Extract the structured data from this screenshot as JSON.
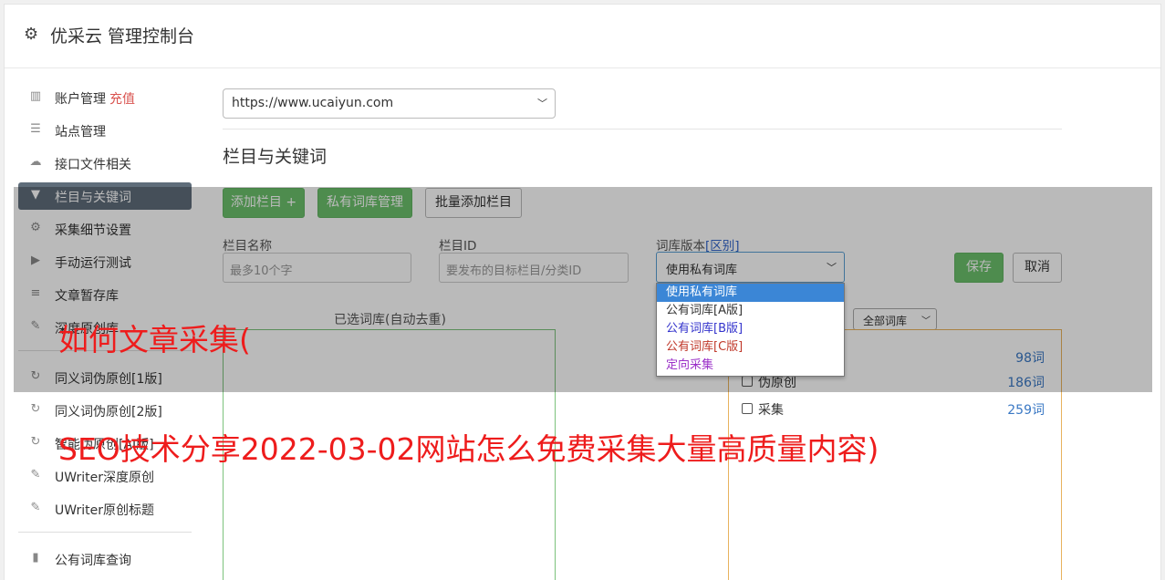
{
  "header": {
    "icon": "gear-icon",
    "title": "优采云 管理控制台"
  },
  "sidebar": {
    "items": [
      {
        "icon": "bar-chart-icon",
        "glyph": "▥",
        "label": "账户管理",
        "extra": "充值"
      },
      {
        "icon": "server-icon",
        "glyph": "☰",
        "label": "站点管理"
      },
      {
        "icon": "cloud-upload-icon",
        "glyph": "☁",
        "label": "接口文件相关"
      },
      {
        "icon": "filter-icon",
        "glyph": "▼",
        "label": "栏目与关键词"
      },
      {
        "icon": "cogs-icon",
        "glyph": "⚙",
        "label": "采集细节设置"
      },
      {
        "icon": "play-circle-icon",
        "glyph": "▶",
        "label": "手动运行测试"
      },
      {
        "icon": "database-icon",
        "glyph": "≡",
        "label": "文章暂存库"
      },
      {
        "icon": "edit-icon",
        "glyph": "✎",
        "label": "深度原创库"
      }
    ],
    "items2": [
      {
        "icon": "refresh-icon",
        "glyph": "↻",
        "label": "同义词伪原创[1版]"
      },
      {
        "icon": "refresh-icon",
        "glyph": "↻",
        "label": "同义词伪原创[2版]"
      },
      {
        "icon": "refresh-icon",
        "glyph": "↻",
        "label": "智能伪原创[AI版]"
      },
      {
        "icon": "edit-icon",
        "glyph": "✎",
        "label": "UWriter深度原创"
      },
      {
        "icon": "edit-icon",
        "glyph": "✎",
        "label": "UWriter原创标题"
      }
    ],
    "items3": [
      {
        "icon": "book-icon",
        "glyph": "▮",
        "label": "公有词库查询"
      }
    ]
  },
  "site_select": {
    "value": "https://www.ucaiyun.com"
  },
  "section": {
    "title": "栏目与关键词"
  },
  "buttons": {
    "add_column": "添加栏目 +",
    "private_lib": "私有词库管理",
    "batch_add": "批量添加栏目",
    "save": "保存",
    "cancel": "取消"
  },
  "form": {
    "column_name_label": "栏目名称",
    "column_name_placeholder": "最多10个字",
    "column_id_label": "栏目ID",
    "column_id_placeholder": "要发布的目标栏目/分类ID",
    "lib_version_label": "词库版本",
    "lib_version_link": "[区别]",
    "lib_version_value": "使用私有词库"
  },
  "dropdown": {
    "options": [
      {
        "label": "使用私有词库",
        "color": "#ffffff",
        "selected": true
      },
      {
        "label": "公有词库[A版]",
        "color": "#333333"
      },
      {
        "label": "公有词库[B版]",
        "color": "#3333cc"
      },
      {
        "label": "公有词库[C版]",
        "color": "#c0392b"
      },
      {
        "label": "定向采集",
        "color": "#9b30c8"
      }
    ]
  },
  "selected_libs": {
    "caption": "已选词库(自动去重)"
  },
  "all_libs": {
    "filter_value": "全部词库",
    "rows": [
      {
        "name": "",
        "count": "98词"
      },
      {
        "name": "伪原创",
        "count": "186词"
      },
      {
        "name": "采集",
        "count": "259词"
      }
    ]
  },
  "captions": {
    "line1": "如何文章采集(",
    "line2": "SEO技术分享2022-03-02网站怎么免费采集大量高质量内容)"
  }
}
